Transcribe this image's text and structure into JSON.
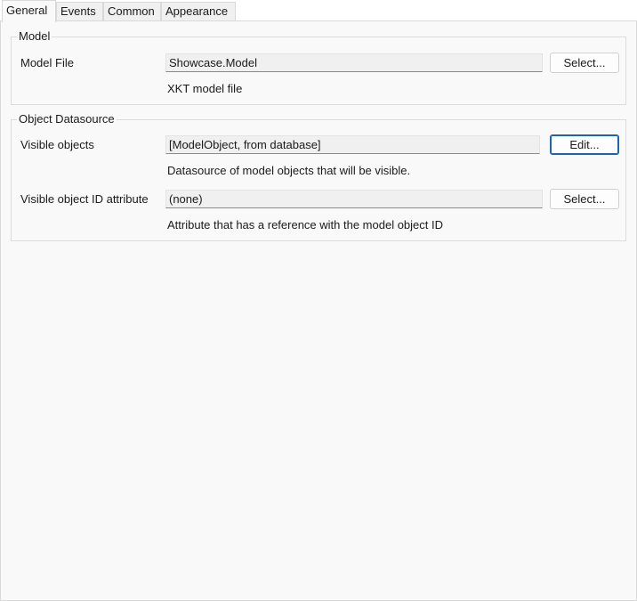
{
  "tabs": [
    "General",
    "Events",
    "Common",
    "Appearance"
  ],
  "active_tab": "General",
  "model_group": {
    "title": "Model",
    "model_file_label": "Model File",
    "model_file_value": "Showcase.Model",
    "model_file_button": "Select...",
    "model_file_hint": "XKT model file"
  },
  "datasource_group": {
    "title": "Object Datasource",
    "visible_objects_label": "Visible objects",
    "visible_objects_value": "[ModelObject, from database]",
    "visible_objects_button": "Edit...",
    "visible_objects_hint": "Datasource of model objects that will be visible.",
    "id_attr_label": "Visible object ID attribute",
    "id_attr_value": "(none)",
    "id_attr_button": "Select...",
    "id_attr_hint": "Attribute that has a reference with the model object ID"
  }
}
